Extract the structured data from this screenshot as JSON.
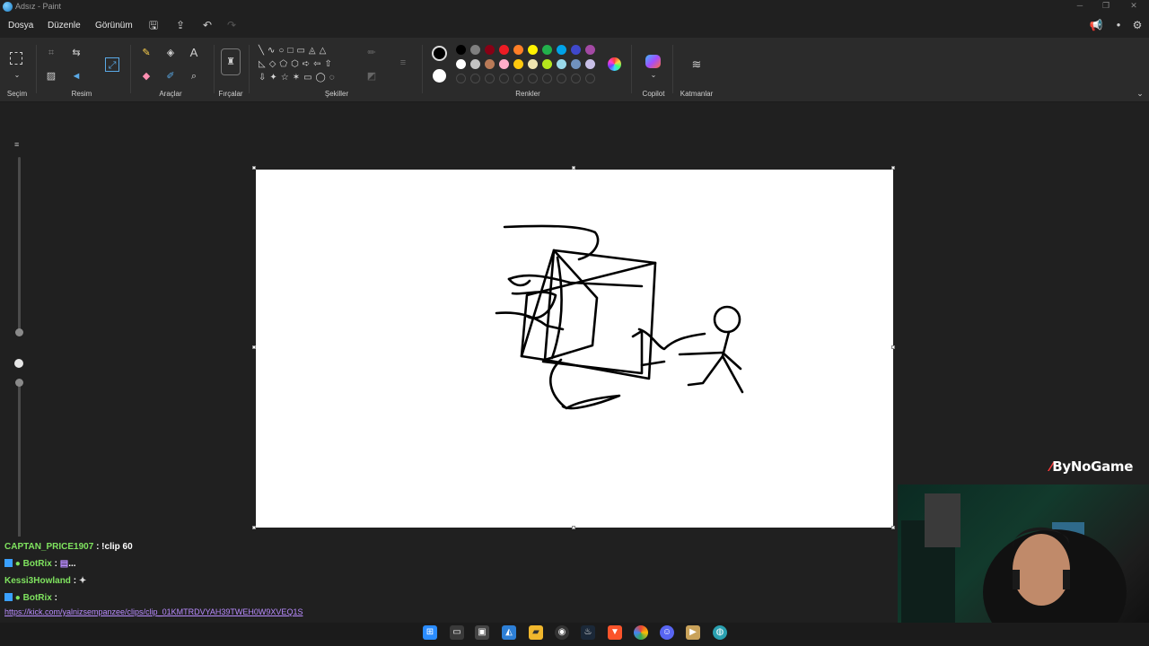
{
  "window": {
    "title": "Adsız - Paint"
  },
  "menu": {
    "file": "Dosya",
    "edit": "Düzenle",
    "view": "Görünüm"
  },
  "ribbon": {
    "groups": {
      "selection": "Seçim",
      "image": "Resim",
      "tools": "Araçlar",
      "brushes": "Fırçalar",
      "shapes": "Şekiller",
      "colors": "Renkler",
      "copilot": "Copilot",
      "layers": "Katmanlar"
    },
    "palette_row1": [
      "#000000",
      "#7f7f7f",
      "#880015",
      "#ed1c24",
      "#ff7f27",
      "#fff200",
      "#22b14c",
      "#00a2e8",
      "#3f48cc",
      "#a349a4"
    ],
    "palette_row2": [
      "#ffffff",
      "#c3c3c3",
      "#b97a57",
      "#ffaec9",
      "#ffc90e",
      "#efe4b0",
      "#b5e61d",
      "#99d9ea",
      "#7092be",
      "#c8bfe7"
    ],
    "primary_color": "#000000",
    "secondary_color": "#ffffff"
  },
  "chat": [
    {
      "user": "CAPTAN_PRICE1907",
      "user_color": "#7fe35f",
      "message": " : !clip 60"
    },
    {
      "user": "BotRix",
      "user_color": "#7fe35f",
      "message": " : ",
      "suffix": "..."
    },
    {
      "user": "Kessi3Howland",
      "user_color": "#7fe35f",
      "message": " : "
    },
    {
      "user": "BotRix",
      "user_color": "#7fe35f",
      "message": " :"
    }
  ],
  "chat_link": "https://kick.com/yalnizsempanzee/clips/clip_01KMTRDVYAH39TWEH0W9XVEQ1S",
  "watermark": "ByNoGame"
}
